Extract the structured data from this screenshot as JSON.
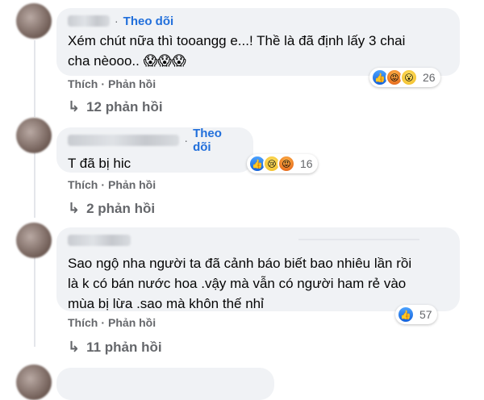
{
  "comments": [
    {
      "follow_label": "Theo dõi",
      "text": "Xém chút nữa thì tooangg e...! Thề là đã định lấy 3 chai\ncha nèooo.. 😱😱😱",
      "reaction_icons": [
        "like-icon",
        "angry-icon",
        "wow-icon"
      ],
      "reaction_count": "26",
      "like_label": "Thích",
      "reply_label": "Phản hồi",
      "replies_label": "12 phản hồi"
    },
    {
      "follow_label": "Theo dõi",
      "text": "T đã bị hic",
      "reaction_icons": [
        "like-icon",
        "sad-icon",
        "angry-icon"
      ],
      "reaction_count": "16",
      "like_label": "Thích",
      "reply_label": "Phản hồi",
      "replies_label": "2 phản hồi"
    },
    {
      "text": "Sao ngộ nha người ta đã cảnh báo biết bao nhiêu lần rồi\nlà k có bán nước hoa .vậy mà vẫn có người ham rẻ vào\nmùa bị lừa .sao mà khôn thế nhỉ",
      "reaction_icons": [
        "like-icon"
      ],
      "reaction_count": "57",
      "like_label": "Thích",
      "reply_label": "Phản hồi",
      "replies_label": "11 phản hồi"
    }
  ],
  "colors": {
    "bubble": "#f0f2f5",
    "follow": "#216fdb",
    "meta": "#65676b",
    "text": "#050505"
  }
}
